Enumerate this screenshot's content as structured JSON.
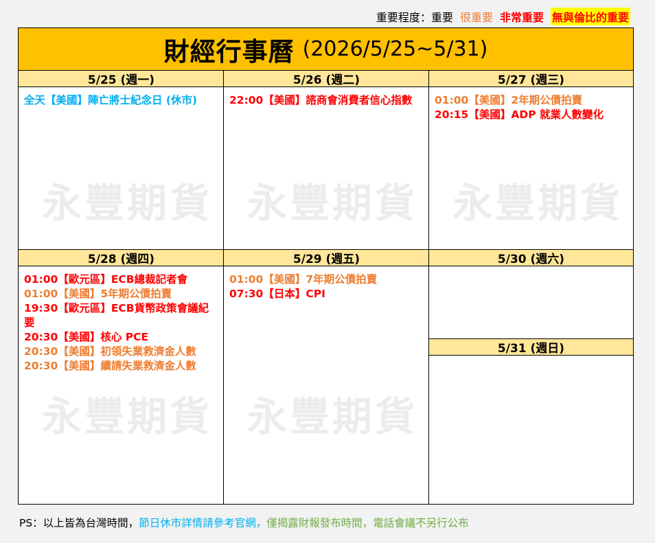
{
  "legend": {
    "prefix": "重要程度：",
    "levels": [
      {
        "label": "重要",
        "color": "#000000"
      },
      {
        "label": "很重要",
        "color": "#ed7d31"
      },
      {
        "label": "非常重要",
        "color": "#ff0000"
      },
      {
        "label": "無與倫比的重要",
        "color": "#ff0000",
        "highlight": "#ffff00"
      }
    ]
  },
  "title": {
    "main": "財經行事曆",
    "range": "(2026/5/25~5/31)",
    "background": "#ffc000"
  },
  "header_color": "#ffe699",
  "watermark": "永豐期貨",
  "colors": {
    "holiday": "#00b0f0",
    "important": "#ed7d31",
    "very_important": "#ff0000"
  },
  "days": [
    {
      "header": "5/25 (週一)",
      "events": [
        {
          "text": "全天【美國】陣亡將士紀念日 (休市)",
          "level": "holiday"
        }
      ]
    },
    {
      "header": "5/26 (週二)",
      "events": [
        {
          "text": "22:00【美國】諮商會消費者信心指數",
          "level": "very_important"
        }
      ]
    },
    {
      "header": "5/27 (週三)",
      "events": [
        {
          "text": "01:00【美國】2年期公債拍賣",
          "level": "important"
        },
        {
          "text": "20:15【美國】ADP 就業人數變化",
          "level": "very_important"
        }
      ]
    },
    {
      "header": "5/28 (週四)",
      "events": [
        {
          "text": "01:00【歐元區】ECB總裁記者會",
          "level": "very_important"
        },
        {
          "text": "01:00【美國】5年期公債拍賣",
          "level": "important"
        },
        {
          "text": "19:30【歐元區】ECB貨幣政策會議紀要",
          "level": "very_important"
        },
        {
          "text": "20:30【美國】核心 PCE",
          "level": "very_important"
        },
        {
          "text": "20:30【美國】初領失業救濟金人數",
          "level": "important"
        },
        {
          "text": "20:30【美國】續請失業救濟金人數",
          "level": "important"
        }
      ]
    },
    {
      "header": "5/29 (週五)",
      "events": [
        {
          "text": "01:00【美國】7年期公債拍賣",
          "level": "important"
        },
        {
          "text": "07:30【日本】CPI",
          "level": "very_important"
        }
      ]
    },
    {
      "header": "5/30 (週六)",
      "events": []
    },
    {
      "header": "5/31 (週日)",
      "events": []
    }
  ],
  "footer": {
    "part1": "PS：以上皆為台灣時間，",
    "part2": "節日休市詳情請參考官網，",
    "part3": "僅揭露財報發布時間，電話會議不另行公布",
    "part1_color": "#000000",
    "part2_color": "#00b0f0",
    "part3_color": "#70ad47"
  }
}
